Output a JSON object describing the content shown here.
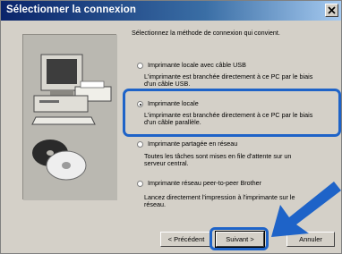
{
  "window": {
    "title": "Sélectionner la connexion"
  },
  "intro": "Sélectionnez la méthode de connexion qui convient.",
  "options": [
    {
      "label": "Imprimante locale avec câble USB",
      "description_line1": "L'imprimante est branchée directement à ce PC par le biais",
      "description_line2": "d'un câble USB.",
      "selected": false
    },
    {
      "label": "Imprimante locale",
      "description_line1": "L'imprimante est branchée directement à ce PC par le biais",
      "description_line2": "d'un câble parallèle.",
      "selected": true
    },
    {
      "label": "Imprimante partagée en réseau",
      "description_line1": "Toutes les tâches sont mises en file d'attente sur un",
      "description_line2": "serveur central.",
      "selected": false
    },
    {
      "label": "Imprimante réseau peer-to-peer Brother",
      "description_line1": "Lancez directement l'impression à l'imprimante sur le",
      "description_line2": "réseau.",
      "selected": false
    }
  ],
  "buttons": {
    "back": "< Précédent",
    "next": "Suivant >",
    "cancel": "Annuler"
  },
  "colors": {
    "callout_highlight": "#1e63c8",
    "title_bar": "#0a246a"
  },
  "icons": {
    "close": "close-icon",
    "pointer": "arrow-pointer-icon"
  }
}
